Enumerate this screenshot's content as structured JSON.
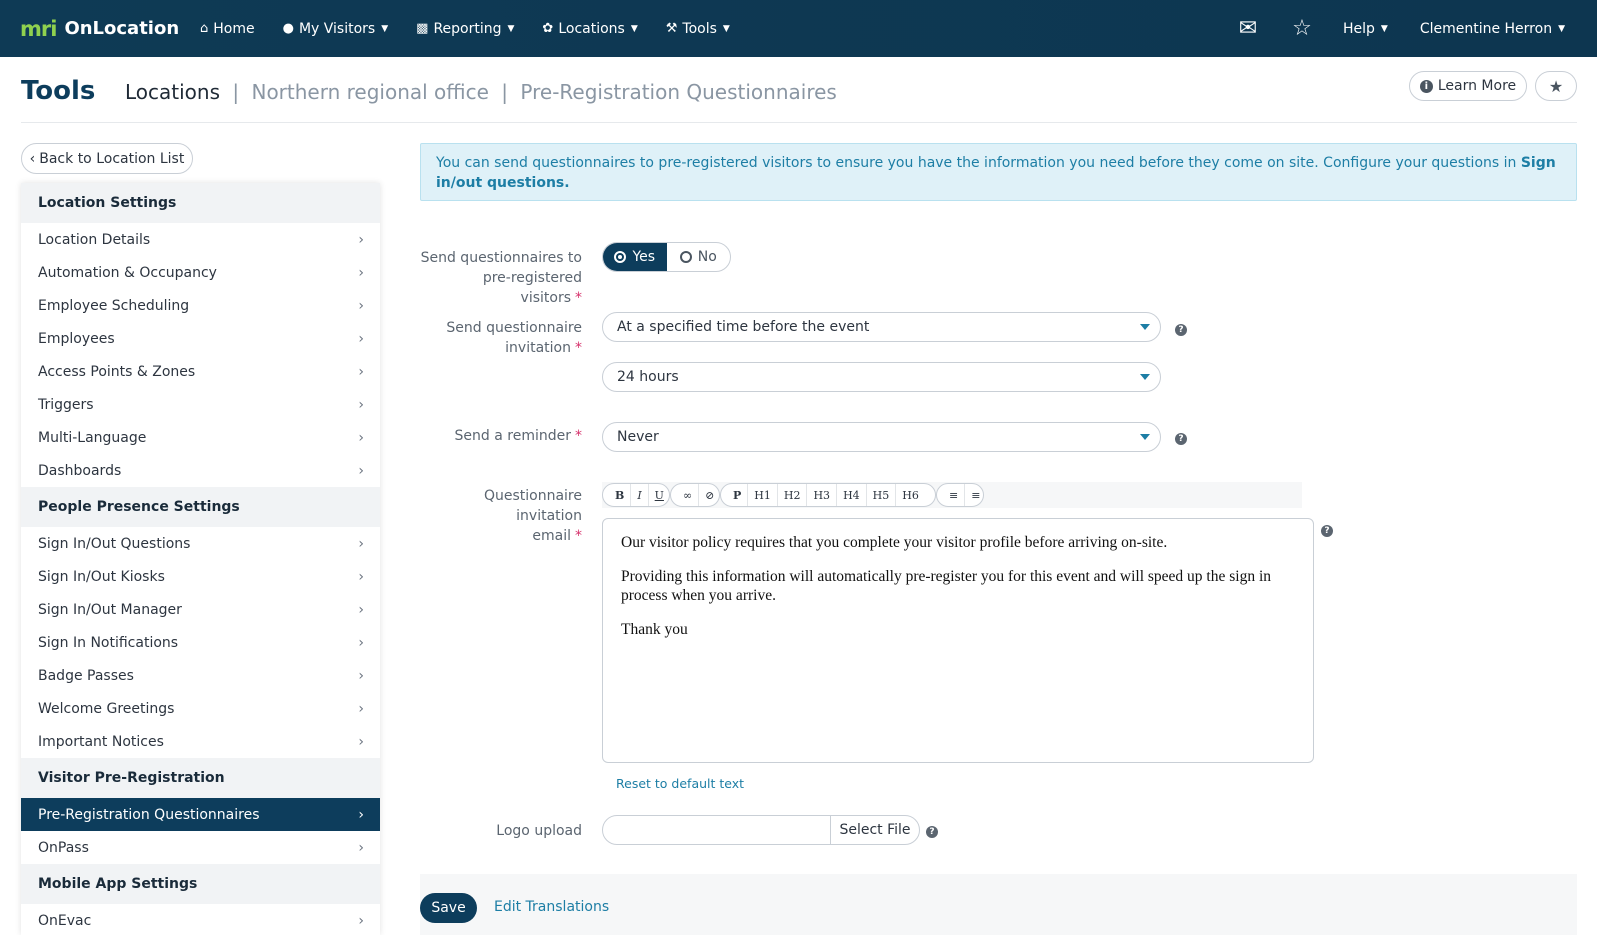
{
  "brand": {
    "logo": "mri",
    "name": "OnLocation",
    "brand_color": "#8fd14f"
  },
  "nav": {
    "items": [
      {
        "label": "Home",
        "icon": "home-icon",
        "dropdown": false
      },
      {
        "label": "My Visitors",
        "icon": "user-icon",
        "dropdown": true
      },
      {
        "label": "Reporting",
        "icon": "bar-chart-icon",
        "dropdown": true
      },
      {
        "label": "Locations",
        "icon": "network-icon",
        "dropdown": true
      },
      {
        "label": "Tools",
        "icon": "wrench-icon",
        "dropdown": true
      }
    ],
    "right": {
      "mail_icon": "mail-icon",
      "star_icon": "star-icon",
      "help": "Help",
      "user": "Clementine Herron"
    },
    "bg_color": "#0d3650"
  },
  "header": {
    "title": "Tools",
    "breadcrumb": {
      "current": "Locations",
      "location": "Northern regional office",
      "page": "Pre-Registration Questionnaires",
      "separator": "|"
    },
    "learn_more": "Learn More"
  },
  "sidebar": {
    "back": "Back to Location List",
    "sections": [
      {
        "title": "Location Settings",
        "items": [
          "Location Details",
          "Automation & Occupancy",
          "Employee Scheduling",
          "Employees",
          "Access Points & Zones",
          "Triggers",
          "Multi-Language",
          "Dashboards"
        ]
      },
      {
        "title": "People Presence Settings",
        "items": [
          "Sign In/Out Questions",
          "Sign In/Out Kiosks",
          "Sign In/Out Manager",
          "Sign In Notifications",
          "Badge Passes",
          "Welcome Greetings",
          "Important Notices"
        ]
      },
      {
        "title": "Visitor Pre-Registration",
        "items": [
          "Pre-Registration Questionnaires",
          "OnPass"
        ]
      },
      {
        "title": "Mobile App Settings",
        "items": [
          "OnEvac"
        ]
      }
    ],
    "active_item": "Pre-Registration Questionnaires",
    "active_color": "#0d3d5c"
  },
  "alert": {
    "text": "You can send questionnaires to pre-registered visitors to ensure you have the information you need before they come on site. Configure your questions in ",
    "link": "Sign in/out questions.",
    "color": "#1d7ea5"
  },
  "form": {
    "send_questionnaires": {
      "label_line1": "Send questionnaires to",
      "label_line2": "pre-registered visitors",
      "yes": "Yes",
      "no": "No",
      "selected": "Yes"
    },
    "send_invitation": {
      "label_line1": "Send questionnaire",
      "label_line2": "invitation",
      "value": "At a specified time before the event",
      "time_value": "24 hours"
    },
    "reminder": {
      "label": "Send a reminder",
      "value": "Never"
    },
    "email": {
      "label_line1": "Questionnaire invitation",
      "label_line2": "email",
      "toolbar": [
        "B",
        "I",
        "U",
        "link",
        "unlink",
        "P",
        "H1",
        "H2",
        "H3",
        "H4",
        "H5",
        "H6",
        "ol",
        "ul"
      ],
      "paragraphs": [
        "Our visitor policy requires that you complete your visitor profile before arriving on-site.",
        "Providing this information will automatically pre-register you for this event and will speed up the sign in process when you arrive.",
        "Thank you"
      ],
      "reset_link": "Reset to default text"
    },
    "logo": {
      "label": "Logo upload",
      "button": "Select File"
    },
    "required_marker": "*"
  },
  "footer": {
    "save": "Save",
    "edit_translations": "Edit Translations"
  }
}
